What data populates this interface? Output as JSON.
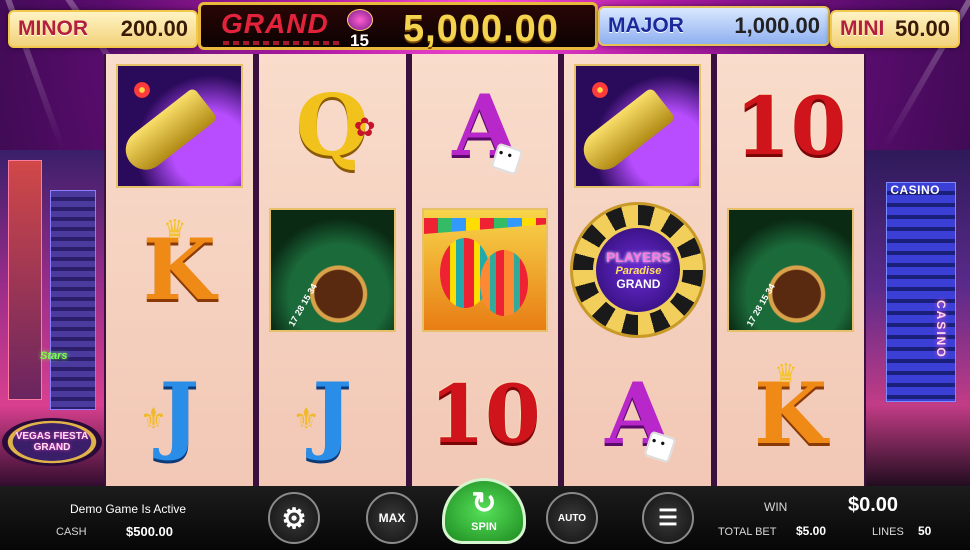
{
  "jackpots": {
    "minor": {
      "label": "MINOR",
      "value": "200.00"
    },
    "grand": {
      "label": "GRAND",
      "count": "15",
      "value": "5,000.00"
    },
    "major": {
      "label": "MAJOR",
      "value": "1,000.00"
    },
    "mini": {
      "label": "MINI",
      "value": "50.00"
    }
  },
  "background": {
    "casino_sign": "CASINO",
    "casino_vertical": "CASINO",
    "left_logo": "VEGAS FIESTA GRAND",
    "star_sign": "Stars"
  },
  "reels": [
    [
      "champagne",
      "K",
      "J"
    ],
    [
      "Q",
      "roulette",
      "J"
    ],
    [
      "A",
      "maracas",
      "10"
    ],
    [
      "champagne",
      "chip",
      "A"
    ],
    [
      "10",
      "roulette",
      "K"
    ]
  ],
  "chip": {
    "line1": "PLAYERS",
    "line2": "Paradise",
    "line3": "GRAND"
  },
  "roulette_numbers": "17 28 15 34",
  "controls": {
    "demo_text": "Demo Game Is Active",
    "cash_label": "CASH",
    "cash_value": "$500.00",
    "max_label": "MAX",
    "spin_label": "SPIN",
    "auto_label": "AUTO",
    "win_label": "WIN",
    "win_value": "$0.00",
    "total_bet_label": "TOTAL BET",
    "total_bet_value": "$5.00",
    "lines_label": "LINES",
    "lines_value": "50"
  },
  "icons": {
    "settings": "gear-icon",
    "max": "speedometer-icon",
    "spin": "spin-arrow-icon",
    "auto": "autoplay-icon",
    "coins": "coin-stack-icon"
  }
}
